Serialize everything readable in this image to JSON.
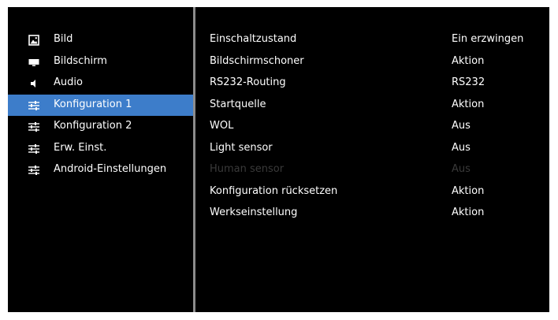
{
  "left_menu": [
    {
      "label": "Bild",
      "icon": "picture-icon",
      "active": false
    },
    {
      "label": "Bildschirm",
      "icon": "monitor-icon",
      "active": false
    },
    {
      "label": "Audio",
      "icon": "speaker-icon",
      "active": false
    },
    {
      "label": "Konfiguration 1",
      "icon": "sliders-icon",
      "active": true
    },
    {
      "label": "Konfiguration 2",
      "icon": "sliders-icon",
      "active": false
    },
    {
      "label": "Erw. Einst.",
      "icon": "sliders-icon",
      "active": false
    },
    {
      "label": "Android-Einstellungen",
      "icon": "sliders-icon",
      "active": false
    }
  ],
  "settings": [
    {
      "label": "Einschaltzustand",
      "value": "Ein erzwingen",
      "enabled": true
    },
    {
      "label": "Bildschirmschoner",
      "value": "Aktion",
      "enabled": true
    },
    {
      "label": "RS232-Routing",
      "value": "RS232",
      "enabled": true
    },
    {
      "label": "Startquelle",
      "value": "Aktion",
      "enabled": true
    },
    {
      "label": "WOL",
      "value": "Aus",
      "enabled": true
    },
    {
      "label": "Light sensor",
      "value": "Aus",
      "enabled": true
    },
    {
      "label": "Human sensor",
      "value": "Aus",
      "enabled": false
    },
    {
      "label": "Konfiguration rücksetzen",
      "value": "Aktion",
      "enabled": true
    },
    {
      "label": "Werkseinstellung",
      "value": "Aktion",
      "enabled": true
    }
  ],
  "colors": {
    "highlight": "#3d7dca",
    "background": "#000000",
    "text": "#ffffff",
    "disabled_text": "#3a3a3a"
  }
}
